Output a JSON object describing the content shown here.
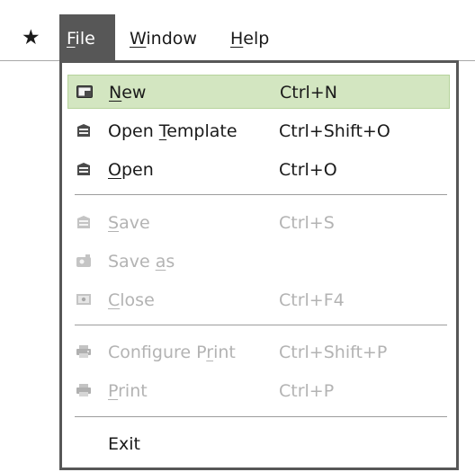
{
  "menubar": {
    "star_glyph": "★",
    "file": {
      "mnemonic": "F",
      "rest": "ile"
    },
    "window": {
      "mnemonic": "W",
      "rest": "indow"
    },
    "help": {
      "mnemonic": "H",
      "rest": "elp"
    }
  },
  "file_menu": {
    "new": {
      "pre": "",
      "mnemonic": "N",
      "post": "ew",
      "shortcut": "Ctrl+N",
      "icon": "new-document-icon",
      "state": "highlighted"
    },
    "open_template": {
      "pre": "Open ",
      "mnemonic": "T",
      "post": "emplate",
      "shortcut": "Ctrl+Shift+O",
      "icon": "open-template-icon",
      "state": "enabled"
    },
    "open": {
      "pre": "",
      "mnemonic": "O",
      "post": "pen",
      "shortcut": "Ctrl+O",
      "icon": "open-icon",
      "state": "enabled"
    },
    "save": {
      "pre": "",
      "mnemonic": "S",
      "post": "ave",
      "shortcut": "Ctrl+S",
      "icon": "save-icon",
      "state": "disabled"
    },
    "save_as": {
      "pre": "Save ",
      "mnemonic": "a",
      "post": "s",
      "shortcut": "",
      "icon": "save-as-icon",
      "state": "disabled"
    },
    "close": {
      "pre": "",
      "mnemonic": "C",
      "post": "lose",
      "shortcut": "Ctrl+F4",
      "icon": "close-icon",
      "state": "disabled"
    },
    "configure_print": {
      "pre": "Configure P",
      "mnemonic": "r",
      "post": "int",
      "shortcut": "Ctrl+Shift+P",
      "icon": "configure-print-icon",
      "state": "disabled"
    },
    "print": {
      "pre": "",
      "mnemonic": "P",
      "post": "rint",
      "shortcut": "Ctrl+P",
      "icon": "printer-icon",
      "state": "disabled"
    },
    "exit": {
      "label": "Exit",
      "state": "enabled"
    }
  },
  "colors": {
    "active_menu_bg": "#575757",
    "highlight_bg": "#d3e6c1",
    "highlight_border": "#b6d39c",
    "disabled_text": "#b3b3b3",
    "text": "#1a1a1a"
  }
}
